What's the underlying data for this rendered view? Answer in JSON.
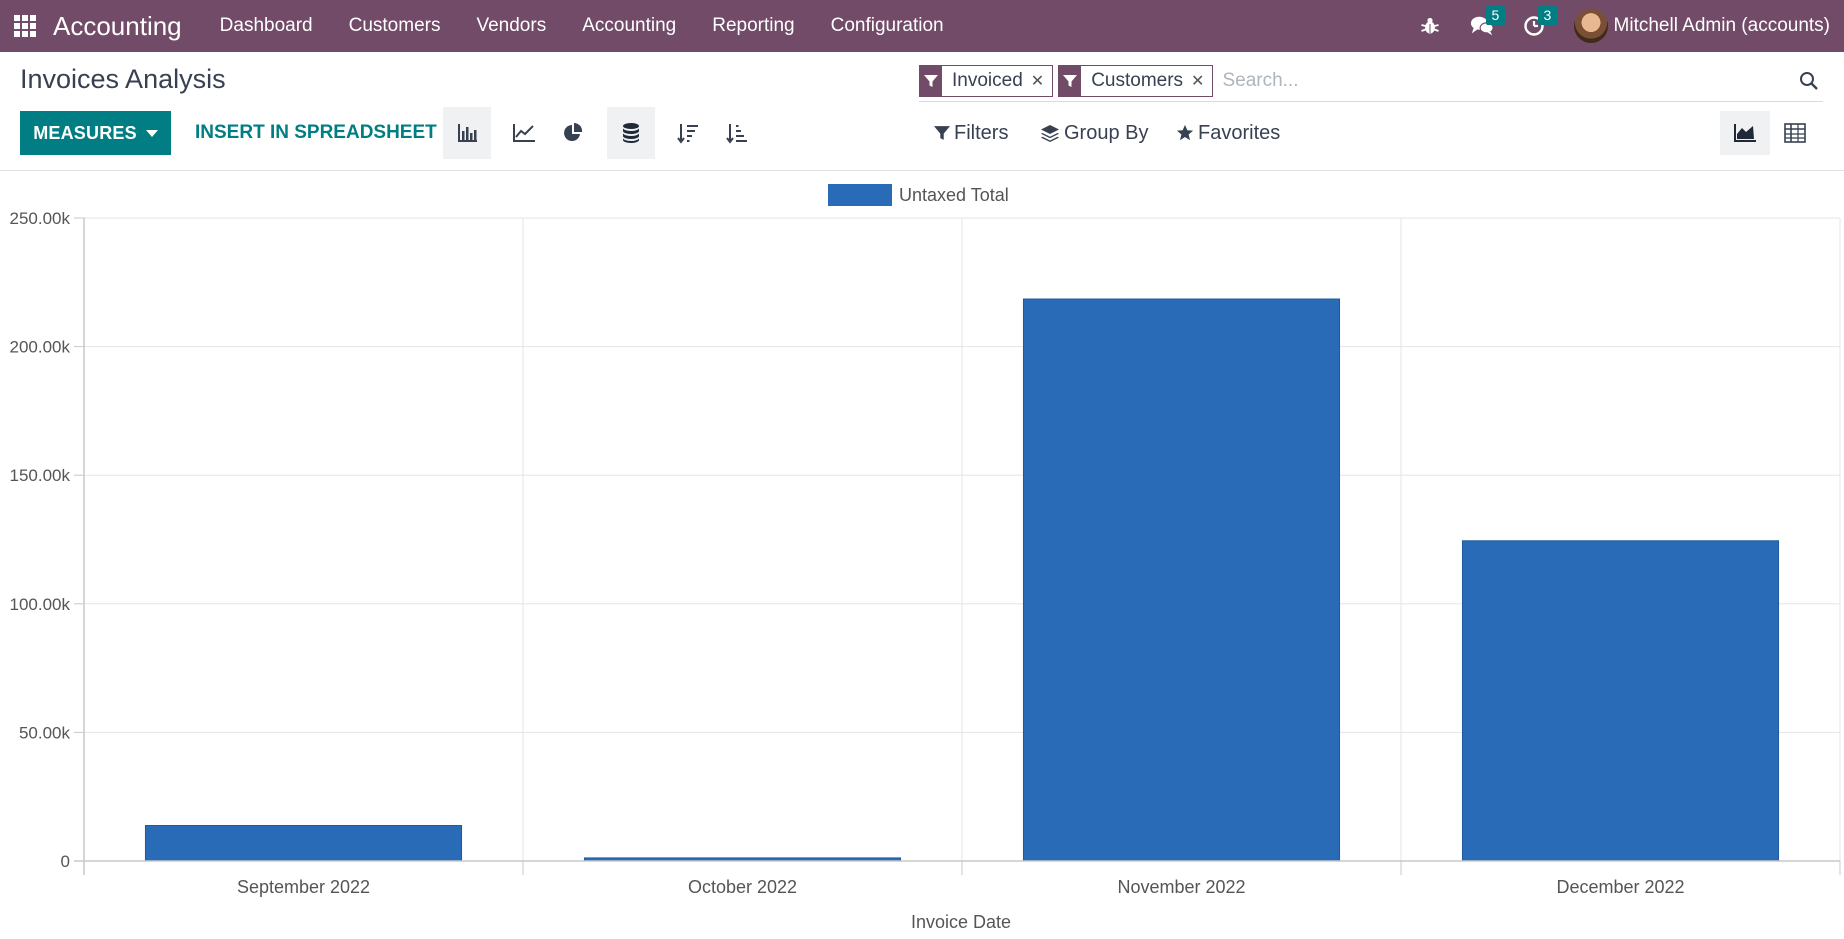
{
  "navbar": {
    "app_name": "Accounting",
    "menu": [
      "Dashboard",
      "Customers",
      "Vendors",
      "Accounting",
      "Reporting",
      "Configuration"
    ],
    "messages_count": "5",
    "activities_count": "3",
    "user_name": "Mitchell Admin (accounts)",
    "color": "#714B67"
  },
  "page": {
    "title": "Invoices Analysis"
  },
  "search": {
    "facets": [
      {
        "label": "Invoiced",
        "icon": "filter-icon"
      },
      {
        "label": "Customers",
        "icon": "filter-icon"
      }
    ],
    "placeholder": "Search..."
  },
  "toolbar": {
    "measures_label": "MEASURES",
    "insert_label": "INSERT IN SPREADSHEET",
    "filters_label": "Filters",
    "groupby_label": "Group By",
    "favorites_label": "Favorites",
    "accent": "#017E84"
  },
  "chart_data": {
    "type": "bar",
    "categories": [
      "September 2022",
      "October 2022",
      "November 2022",
      "December 2022"
    ],
    "series": [
      {
        "name": "Untaxed Total",
        "values": [
          13800,
          1200,
          218500,
          124500
        ],
        "color": "#2A6BB8"
      }
    ],
    "xlabel": "Invoice Date",
    "ylabel": "",
    "ylim": [
      0,
      250000
    ],
    "y_ticks": [
      "0",
      "50.00k",
      "100.00k",
      "150.00k",
      "200.00k",
      "250.00k"
    ],
    "grid": true,
    "legend": "top-center"
  }
}
